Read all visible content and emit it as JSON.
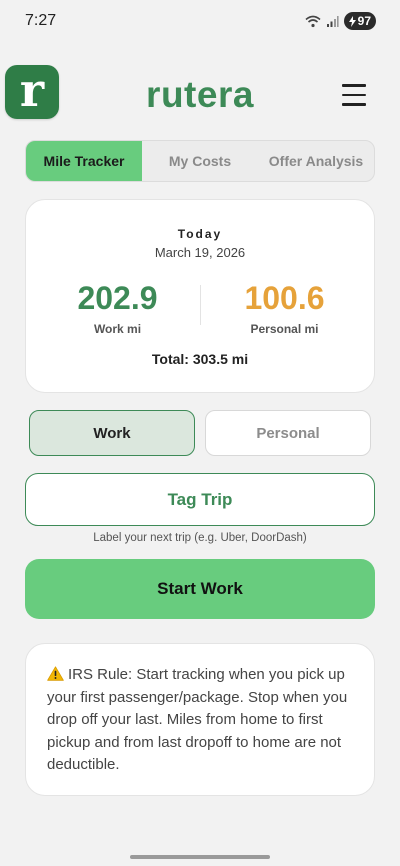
{
  "status_bar": {
    "time": "7:27",
    "battery": "97"
  },
  "header": {
    "logo_letter": "r",
    "title": "rutera"
  },
  "tabs": [
    {
      "label": "Mile Tracker",
      "active": true
    },
    {
      "label": "My Costs",
      "active": false
    },
    {
      "label": "Offer Analysis",
      "active": false
    }
  ],
  "summary": {
    "heading": "Today",
    "date": "March 19, 2026",
    "work_value": "202.9",
    "work_label": "Work mi",
    "personal_value": "100.6",
    "personal_label": "Personal mi",
    "total": "Total: 303.5 mi"
  },
  "mode": {
    "work_label": "Work",
    "personal_label": "Personal",
    "selected": "Work"
  },
  "tag_trip": {
    "label": "Tag Trip",
    "hint": "Label your next trip (e.g. Uber, DoorDash)"
  },
  "start_button": {
    "label": "Start Work"
  },
  "irs_notice": {
    "text": "IRS Rule: Start tracking when you pick up your first passenger/package. Stop when you drop off your last. Miles from home to first pickup and from last dropoff to home are not deductible."
  },
  "colors": {
    "brand_green": "#3d8a57",
    "accent_green": "#68cc7e",
    "personal_orange": "#e6a23a"
  },
  "icons": [
    "wifi-icon",
    "signal-icon",
    "battery-icon",
    "menu-icon",
    "warning-icon"
  ]
}
